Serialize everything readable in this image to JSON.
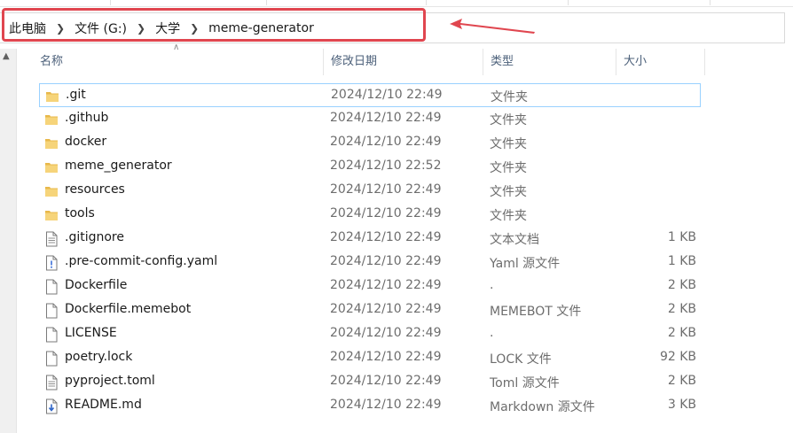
{
  "breadcrumb": [
    "此电脑",
    "文件 (G:)",
    "大学",
    "meme-generator"
  ],
  "columns": {
    "name": "名称",
    "date": "修改日期",
    "type": "类型",
    "size": "大小"
  },
  "accent": {
    "highlight": "#e0464f",
    "folder": "#f2c55c",
    "selection": "#99d1ff"
  },
  "files": [
    {
      "name": ".git",
      "date": "2024/12/10 22:49",
      "type": "文件夹",
      "size": "",
      "icon": "folder-icon"
    },
    {
      "name": ".github",
      "date": "2024/12/10 22:49",
      "type": "文件夹",
      "size": "",
      "icon": "folder-icon"
    },
    {
      "name": "docker",
      "date": "2024/12/10 22:49",
      "type": "文件夹",
      "size": "",
      "icon": "folder-icon"
    },
    {
      "name": "meme_generator",
      "date": "2024/12/10 22:52",
      "type": "文件夹",
      "size": "",
      "icon": "folder-icon"
    },
    {
      "name": "resources",
      "date": "2024/12/10 22:49",
      "type": "文件夹",
      "size": "",
      "icon": "folder-icon"
    },
    {
      "name": "tools",
      "date": "2024/12/10 22:49",
      "type": "文件夹",
      "size": "",
      "icon": "folder-icon"
    },
    {
      "name": ".gitignore",
      "date": "2024/12/10 22:49",
      "type": "文本文档",
      "size": "1 KB",
      "icon": "text-file-icon"
    },
    {
      "name": ".pre-commit-config.yaml",
      "date": "2024/12/10 22:49",
      "type": "Yaml 源文件",
      "size": "1 KB",
      "icon": "yaml-file-icon"
    },
    {
      "name": "Dockerfile",
      "date": "2024/12/10 22:49",
      "type": ".",
      "size": "2 KB",
      "icon": "blank-file-icon"
    },
    {
      "name": "Dockerfile.memebot",
      "date": "2024/12/10 22:49",
      "type": "MEMEBOT 文件",
      "size": "2 KB",
      "icon": "blank-file-icon"
    },
    {
      "name": "LICENSE",
      "date": "2024/12/10 22:49",
      "type": ".",
      "size": "2 KB",
      "icon": "blank-file-icon"
    },
    {
      "name": "poetry.lock",
      "date": "2024/12/10 22:49",
      "type": "LOCK 文件",
      "size": "92 KB",
      "icon": "blank-file-icon"
    },
    {
      "name": "pyproject.toml",
      "date": "2024/12/10 22:49",
      "type": "Toml 源文件",
      "size": "2 KB",
      "icon": "text-file-icon"
    },
    {
      "name": "README.md",
      "date": "2024/12/10 22:49",
      "type": "Markdown 源文件",
      "size": "3 KB",
      "icon": "markdown-file-icon"
    }
  ]
}
